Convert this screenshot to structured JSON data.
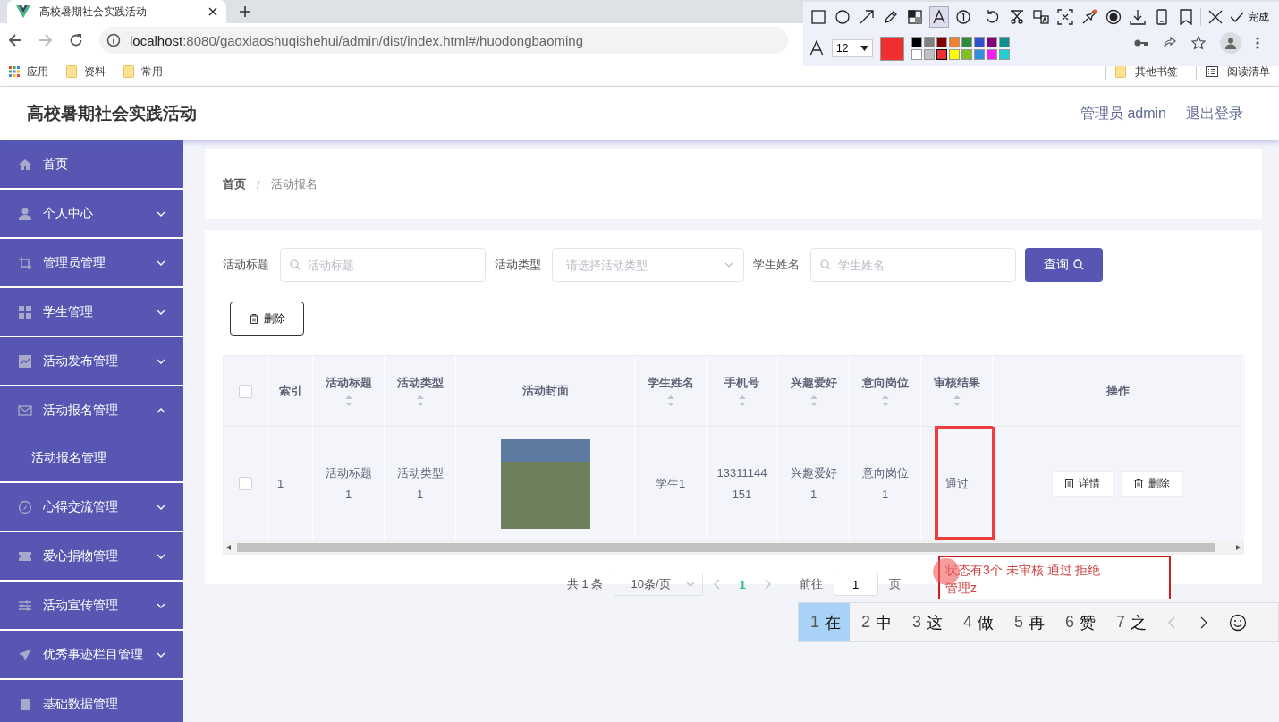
{
  "browser": {
    "tab_title": "高校暑期社会实践活动",
    "url_host": "localhost",
    "url_rest": ":8080/gaoxiaoshuqishehui/admin/dist/index.html#/huodongbaoming",
    "bookmarks": [
      "应用",
      "资料",
      "常用"
    ],
    "other_bookmarks": "其他书签",
    "reading_list": "阅读清单"
  },
  "annotation_toolbar": {
    "tools": [
      {
        "kind": "rect",
        "selected": false
      },
      {
        "kind": "circle",
        "selected": false
      },
      {
        "kind": "arrow",
        "selected": false
      },
      {
        "kind": "pen",
        "selected": false
      },
      {
        "kind": "mosaic",
        "selected": false
      },
      {
        "kind": "text",
        "selected": true
      },
      {
        "kind": "number",
        "selected": false
      },
      {
        "kind": "undo",
        "selected": false
      },
      {
        "kind": "cut",
        "selected": false
      },
      {
        "kind": "translate",
        "selected": false
      },
      {
        "kind": "scan",
        "selected": false
      },
      {
        "kind": "pin",
        "selected": false
      },
      {
        "kind": "record",
        "selected": false
      },
      {
        "kind": "download",
        "selected": false
      },
      {
        "kind": "phone",
        "selected": false
      },
      {
        "kind": "bookmark",
        "selected": false
      },
      {
        "kind": "close",
        "selected": false
      }
    ],
    "done": "完成",
    "font_size": "12",
    "palette": [
      {
        "color": "#000000"
      },
      {
        "color": "#808080"
      },
      {
        "color": "#800000"
      },
      {
        "color": "#f08030"
      },
      {
        "color": "#2e8b3a"
      },
      {
        "color": "#3050d0"
      },
      {
        "color": "#800080"
      },
      {
        "color": "#109090"
      },
      {
        "color": "#ffffff"
      },
      {
        "color": "#c0c0c0"
      },
      {
        "color": "#f03030",
        "selected": true
      },
      {
        "color": "#ffff00"
      },
      {
        "color": "#80c020"
      },
      {
        "color": "#3090e0"
      },
      {
        "color": "#f020f0"
      },
      {
        "color": "#20d0d0"
      }
    ]
  },
  "header": {
    "title": "高校暑期社会实践活动",
    "user": "管理员 admin",
    "logout": "退出登录"
  },
  "sidebar": {
    "items": [
      {
        "label": "首页",
        "expandable": false
      },
      {
        "label": "个人中心",
        "expandable": true,
        "expanded": false
      },
      {
        "label": "管理员管理",
        "expandable": true,
        "expanded": false
      },
      {
        "label": "学生管理",
        "expandable": true,
        "expanded": false
      },
      {
        "label": "活动发布管理",
        "expandable": true,
        "expanded": false
      },
      {
        "label": "活动报名管理",
        "expandable": true,
        "expanded": true,
        "children": [
          {
            "label": "活动报名管理"
          }
        ]
      },
      {
        "label": "心得交流管理",
        "expandable": true,
        "expanded": false
      },
      {
        "label": "爱心捐物管理",
        "expandable": true,
        "expanded": false
      },
      {
        "label": "活动宣传管理",
        "expandable": true,
        "expanded": false
      },
      {
        "label": "优秀事迹栏目管理",
        "expandable": true,
        "expanded": false
      },
      {
        "label": "基础数据管理",
        "expandable": false
      }
    ]
  },
  "breadcrumb": {
    "items": [
      "首页",
      "活动报名"
    ],
    "separator": "/"
  },
  "search": {
    "fields": [
      {
        "label": "活动标题",
        "placeholder": "活动标题",
        "kind": "input"
      },
      {
        "label": "活动类型",
        "placeholder": "请选择活动类型",
        "kind": "select"
      },
      {
        "label": "学生姓名",
        "placeholder": "学生姓名",
        "kind": "input"
      }
    ],
    "query_button": "查询"
  },
  "delete_button": "删除",
  "table": {
    "columns": [
      {
        "kind": "check",
        "checked": false
      },
      {
        "kind": "text",
        "label": "索引",
        "sortable": false
      },
      {
        "kind": "text",
        "label": "活动标题",
        "sortable": true
      },
      {
        "kind": "text",
        "label": "活动类型",
        "sortable": true
      },
      {
        "kind": "image",
        "label": "活动封面",
        "sortable": false
      },
      {
        "kind": "text",
        "label": "学生姓名",
        "sortable": true
      },
      {
        "kind": "text",
        "label": "手机号",
        "sortable": true
      },
      {
        "kind": "text",
        "label": "兴趣爱好",
        "sortable": true
      },
      {
        "kind": "text",
        "label": "意向岗位",
        "sortable": true
      },
      {
        "kind": "text",
        "label": "审核结果",
        "sortable": true
      },
      {
        "kind": "actions",
        "label": "操作",
        "sortable": false
      }
    ],
    "rows": [
      {
        "checked": false,
        "cells": [
          {
            "kind": "check"
          },
          {
            "kind": "text",
            "text": "1"
          },
          {
            "kind": "text",
            "text": "活动标题1"
          },
          {
            "kind": "text",
            "text": "活动类型1"
          },
          {
            "kind": "image"
          },
          {
            "kind": "text",
            "text": "学生1"
          },
          {
            "kind": "text",
            "text": "13311144151"
          },
          {
            "kind": "text",
            "text": "兴趣爱好1"
          },
          {
            "kind": "text",
            "text": "意向岗位1"
          },
          {
            "kind": "text",
            "text": "通过",
            "annotated": true
          },
          {
            "kind": "actions",
            "buttons": [
              "详情",
              "删除"
            ]
          }
        ]
      }
    ]
  },
  "pagination": {
    "total": "共 1 条",
    "page_size": "10条/页",
    "pages": [
      {
        "label": "1",
        "selected": true
      }
    ],
    "goto": "前往",
    "goto_value": "1",
    "goto_suffix": "页"
  },
  "note": {
    "lines": [
      "状态有3个 未审核 通过 拒绝",
      "管理z"
    ]
  },
  "ime": {
    "candidates": [
      {
        "num": "1",
        "char": "在",
        "selected": true
      },
      {
        "num": "2",
        "char": "中",
        "selected": false
      },
      {
        "num": "3",
        "char": "这",
        "selected": false
      },
      {
        "num": "4",
        "char": "做",
        "selected": false
      },
      {
        "num": "5",
        "char": "再",
        "selected": false
      },
      {
        "num": "6",
        "char": "赞",
        "selected": false
      },
      {
        "num": "7",
        "char": "之",
        "selected": false
      }
    ]
  }
}
